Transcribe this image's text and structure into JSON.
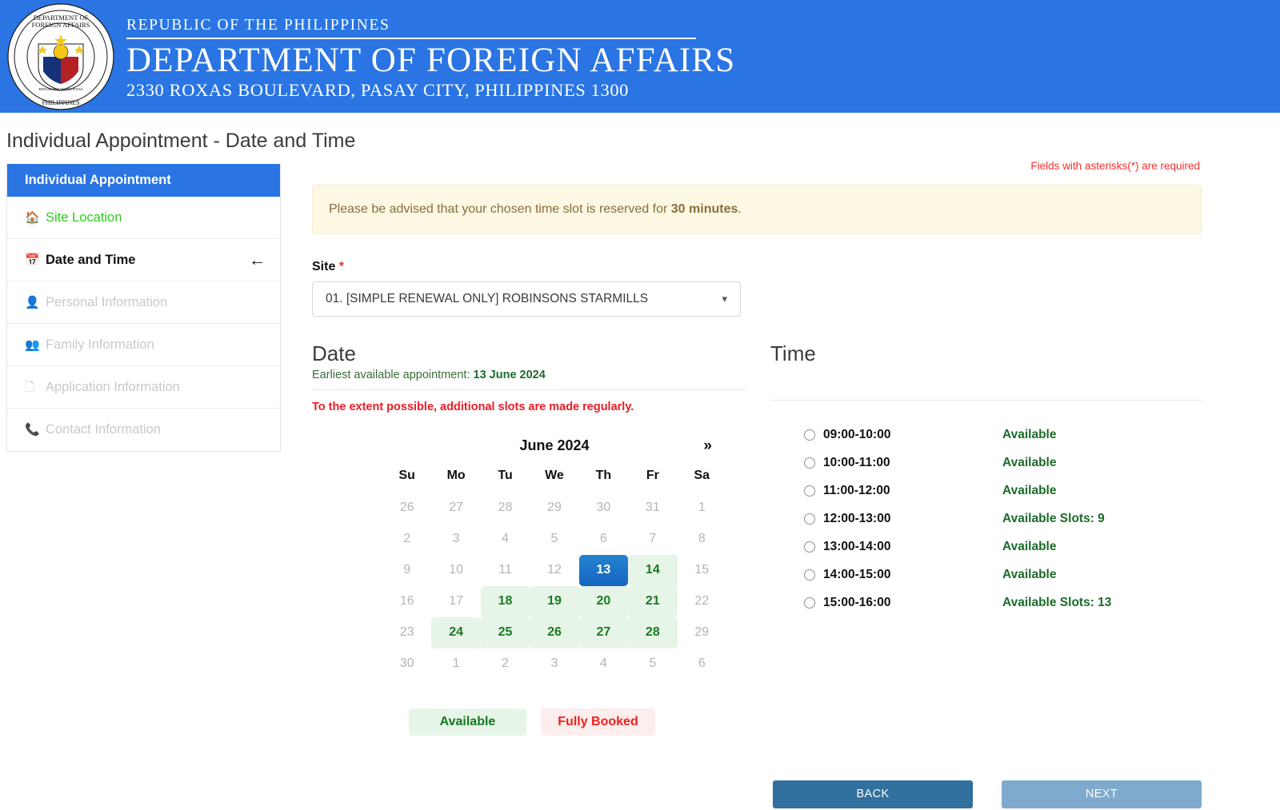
{
  "header": {
    "seal_alt": "dfa-seal",
    "line1": "REPUBLIC OF THE PHILIPPINES",
    "line2": "DEPARTMENT OF FOREIGN AFFAIRS",
    "line3": "2330 ROXAS BOULEVARD, PASAY CITY, PHILIPPINES 1300",
    "bg_color": "#2a75e3"
  },
  "page_title": "Individual Appointment - Date and Time",
  "sidebar": {
    "title": "Individual Appointment",
    "items": [
      {
        "label": "Site Location",
        "icon": "home-icon",
        "state": "done"
      },
      {
        "label": "Date and Time",
        "icon": "calendar-icon",
        "state": "active",
        "arrow": "←"
      },
      {
        "label": "Personal Information",
        "icon": "user-icon",
        "state": "disabled"
      },
      {
        "label": "Family Information",
        "icon": "users-icon",
        "state": "disabled"
      },
      {
        "label": "Application Information",
        "icon": "form-icon",
        "state": "disabled"
      },
      {
        "label": "Contact Information",
        "icon": "phone-icon",
        "state": "disabled"
      }
    ]
  },
  "required_note": "Fields with asterisks(*) are required",
  "alert": {
    "text_before": "Please be advised that your chosen time slot is reserved for ",
    "highlight": "30 minutes",
    "text_after": "."
  },
  "site": {
    "label": "Site",
    "required_marker": "*",
    "value": "01. [SIMPLE RENEWAL ONLY] ROBINSONS STARMILLS",
    "chevron": "⌄"
  },
  "date_section": {
    "title": "Date",
    "earliest_prefix": "Earliest available appointment: ",
    "earliest_value": "13 June 2024",
    "note": "To the extent possible, additional slots are made regularly.",
    "month_label": "June 2024",
    "next_arrow": "»",
    "weekdays": [
      "Su",
      "Mo",
      "Tu",
      "We",
      "Th",
      "Fr",
      "Sa"
    ],
    "weeks": [
      [
        {
          "d": "26",
          "s": "out"
        },
        {
          "d": "27",
          "s": "out"
        },
        {
          "d": "28",
          "s": "out"
        },
        {
          "d": "29",
          "s": "out"
        },
        {
          "d": "30",
          "s": "out"
        },
        {
          "d": "31",
          "s": "out"
        },
        {
          "d": "1",
          "s": "out"
        }
      ],
      [
        {
          "d": "2",
          "s": "off"
        },
        {
          "d": "3",
          "s": "off"
        },
        {
          "d": "4",
          "s": "off"
        },
        {
          "d": "5",
          "s": "off"
        },
        {
          "d": "6",
          "s": "off"
        },
        {
          "d": "7",
          "s": "off"
        },
        {
          "d": "8",
          "s": "off"
        }
      ],
      [
        {
          "d": "9",
          "s": "off"
        },
        {
          "d": "10",
          "s": "off"
        },
        {
          "d": "11",
          "s": "off"
        },
        {
          "d": "12",
          "s": "off"
        },
        {
          "d": "13",
          "s": "sel"
        },
        {
          "d": "14",
          "s": "avail"
        },
        {
          "d": "15",
          "s": "off"
        }
      ],
      [
        {
          "d": "16",
          "s": "off"
        },
        {
          "d": "17",
          "s": "off"
        },
        {
          "d": "18",
          "s": "avail"
        },
        {
          "d": "19",
          "s": "avail"
        },
        {
          "d": "20",
          "s": "avail"
        },
        {
          "d": "21",
          "s": "avail"
        },
        {
          "d": "22",
          "s": "off"
        }
      ],
      [
        {
          "d": "23",
          "s": "off"
        },
        {
          "d": "24",
          "s": "avail"
        },
        {
          "d": "25",
          "s": "avail"
        },
        {
          "d": "26",
          "s": "avail"
        },
        {
          "d": "27",
          "s": "avail"
        },
        {
          "d": "28",
          "s": "avail"
        },
        {
          "d": "29",
          "s": "off"
        }
      ],
      [
        {
          "d": "30",
          "s": "off"
        },
        {
          "d": "1",
          "s": "out"
        },
        {
          "d": "2",
          "s": "out"
        },
        {
          "d": "3",
          "s": "out"
        },
        {
          "d": "4",
          "s": "out"
        },
        {
          "d": "5",
          "s": "out"
        },
        {
          "d": "6",
          "s": "out"
        }
      ]
    ],
    "legend": [
      {
        "label": "Available",
        "kind": "available"
      },
      {
        "label": "Fully Booked",
        "kind": "fully-booked"
      }
    ]
  },
  "time_section": {
    "title": "Time",
    "slots": [
      {
        "time": "09:00-10:00",
        "status": "Available",
        "selected": false
      },
      {
        "time": "10:00-11:00",
        "status": "Available",
        "selected": false
      },
      {
        "time": "11:00-12:00",
        "status": "Available",
        "selected": false
      },
      {
        "time": "12:00-13:00",
        "status": "Available Slots: 9",
        "selected": false
      },
      {
        "time": "13:00-14:00",
        "status": "Available",
        "selected": false
      },
      {
        "time": "14:00-15:00",
        "status": "Available",
        "selected": false
      },
      {
        "time": "15:00-16:00",
        "status": "Available Slots: 13",
        "selected": false
      }
    ]
  },
  "buttons": {
    "back": "BACK",
    "next": "NEXT"
  },
  "colors": {
    "brand_blue": "#2a75e3",
    "available_green": "#1a7a23",
    "available_bg": "#e7f4e8",
    "booked_red": "#f5201c",
    "booked_bg": "#fdeeee",
    "alert_bg": "#fcf8e3",
    "alert_text": "#8a6d3b",
    "selected_day": "#1565c0",
    "back_button": "#31709f",
    "next_button": "#7faacd"
  }
}
